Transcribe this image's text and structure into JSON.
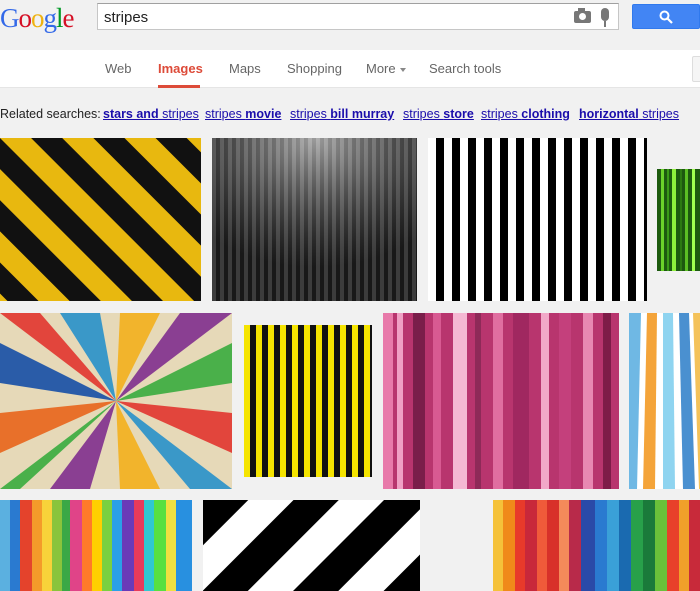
{
  "header": {
    "logo_letters": [
      "G",
      "o",
      "o",
      "g",
      "l",
      "e"
    ],
    "search_value": "stripes"
  },
  "nav": {
    "web": "Web",
    "images": "Images",
    "maps": "Maps",
    "shopping": "Shopping",
    "more": "More",
    "search_tools": "Search tools"
  },
  "related": {
    "label": "Related searches:",
    "links": [
      {
        "pre": "",
        "bold": "stars and",
        "post": " stripes"
      },
      {
        "pre": "stripes ",
        "bold": "movie",
        "post": ""
      },
      {
        "pre": "stripes ",
        "bold": "bill murray",
        "post": ""
      },
      {
        "pre": "stripes ",
        "bold": "store",
        "post": ""
      },
      {
        "pre": "stripes ",
        "bold": "clothing",
        "post": ""
      },
      {
        "pre": "",
        "bold": "horizontal",
        "post": " stripes"
      }
    ]
  },
  "results": [
    {
      "name": "yellow-black-diagonal"
    },
    {
      "name": "grey-vertical-gradient"
    },
    {
      "name": "black-white-vertical"
    },
    {
      "name": "green-vertical"
    },
    {
      "name": "rainbow-starburst"
    },
    {
      "name": "yellow-black-vertical"
    },
    {
      "name": "pink-vertical"
    },
    {
      "name": "pastel-vertical"
    },
    {
      "name": "rainbow-vertical"
    },
    {
      "name": "black-white-diagonal"
    },
    {
      "name": "multicolor-vertical"
    }
  ]
}
